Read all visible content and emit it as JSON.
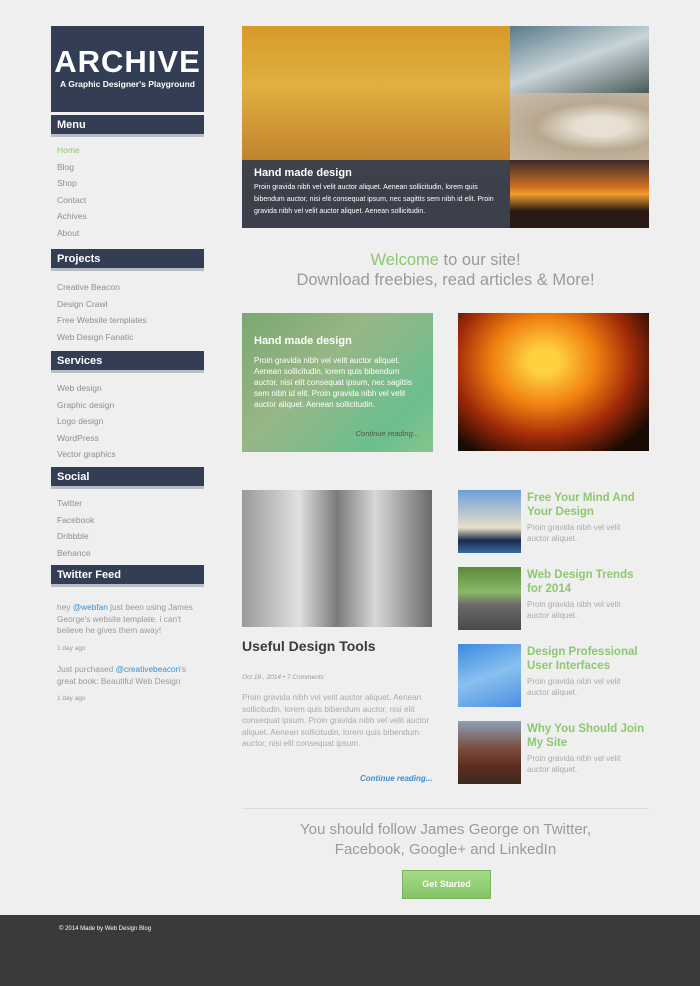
{
  "logo": {
    "title": "ARCHIVE",
    "tagline": "A Graphic Designer's Playground"
  },
  "sidebar": {
    "menu": {
      "title": "Menu",
      "items": [
        "Home",
        "Blog",
        "Shop",
        "Contact",
        "Achives",
        "About"
      ],
      "active": "Home"
    },
    "projects": {
      "title": "Projects",
      "items": [
        "Creative Beacon",
        "Design Crawl",
        "Free Website templates",
        "Web Design Fanatic"
      ]
    },
    "services": {
      "title": "Services",
      "items": [
        "Web design",
        "Graphic design",
        "Logo design",
        "WordPress",
        "Vector graphics"
      ]
    },
    "social": {
      "title": "Social",
      "items": [
        "Twitter",
        "Facebook",
        "Dribbble",
        "Behance"
      ]
    },
    "twitter": {
      "title": "Twitter Feed",
      "tweets": [
        {
          "pre": "hey ",
          "handle": "@webfan",
          "post": " just been using James George's website template. i can't believe he gives them away!",
          "time": "1 day ago"
        },
        {
          "pre": "Just purchased ",
          "handle": "@creativebeacon",
          "post": "'s great book: Beautiful Web Design",
          "time": "1 day ago"
        }
      ]
    }
  },
  "hero": {
    "title": "Hand made design",
    "text": "Proin gravida nibh vel velit auctor aliquet. Aenean sollicitudin, lorem quis bibendum auctor, nisi elit consequat ipsum, nec sagittis sem nibh id elit. Proin gravida nibh vel velit auctor aliquet. Aenean sollicitudin."
  },
  "welcome": {
    "highlight": "Welcome",
    "rest": " to our site!",
    "line2": "Download freebies, read articles & More!"
  },
  "card": {
    "title": "Hand made design",
    "text": "Proin gravida nibh vel velit auctor aliquet. Aenean sollicitudin, lorem quis bibendum auctor, nisi elit consequat ipsum, nec sagittis sem nibh id elit. Proin gravida nibh vel velit auctor aliquet. Aenean sollicitudin.",
    "link": "Continue reading..."
  },
  "article": {
    "title": "Useful Design Tools",
    "meta": "Oct 18 , 2014 • 7 Comments",
    "text": "Proin gravida nibh vel velit auctor aliquet. Aenean sollicitudin, lorem quis bibendum auctor, nisi elit consequat ipsum. Proin gravida nibh vel velit auctor aliquet. Aenean sollicitudin, lorem quis bibendum auctor, nisi elit consequat ipsum.",
    "link": "Continue reading..."
  },
  "posts": [
    {
      "title": "Free Your Mind And Your Design",
      "text": "Proin gravida nibh vel velit auctor aliquet."
    },
    {
      "title": "Web Design Trends for 2014",
      "text": "Proin gravida nibh vel velit auctor aliquet."
    },
    {
      "title": "Design Professional User Interfaces",
      "text": "Proin gravida nibh vel velit auctor aliquet."
    },
    {
      "title": "Why You Should Join My Site",
      "text": "Proin gravida nibh vel velit auctor aliquet."
    }
  ],
  "follow": {
    "text": "You should follow James George on Twitter, Facebook, Google+ and LinkedIn",
    "button": "Get Started"
  },
  "footer": {
    "text": "© 2014 Made by Web Design Blog"
  },
  "colors": {
    "navy": "#333e55",
    "green": "#8cc870",
    "link": "#3d8fcf",
    "footer": "#3a3a3a"
  }
}
